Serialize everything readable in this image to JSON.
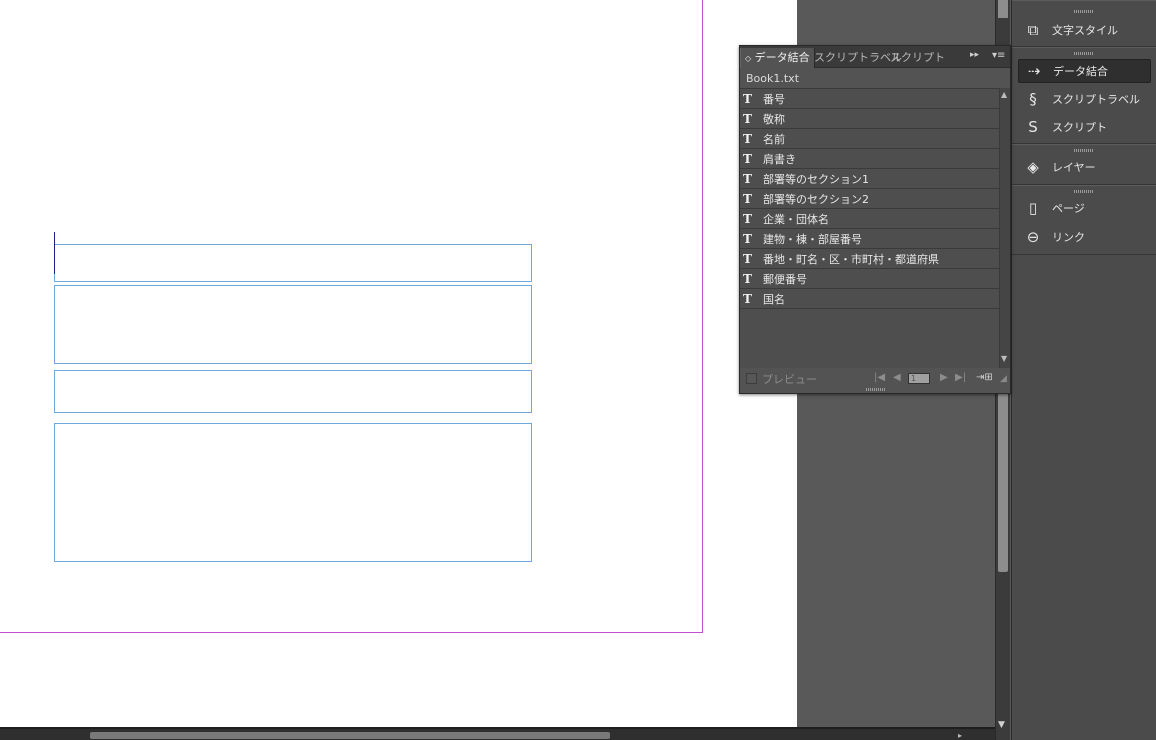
{
  "panel": {
    "tabs": [
      {
        "label": "データ結合"
      },
      {
        "label": "スクリプトラベル"
      },
      {
        "label": "スクリプト"
      }
    ],
    "collapse_glyph": "▸▸",
    "menu_glyph": "▾≡",
    "tab_arrow_glyph": "◇",
    "source_name": "Book1.txt",
    "field_icon_glyph": "T",
    "fields": [
      "番号",
      "敬称",
      "名前",
      "肩書き",
      "部署等のセクション1",
      "部署等のセクション2",
      "企業・団体名",
      "建物・棟・部屋番号",
      "番地・町名・区・市町村・都道府県",
      "郵便番号",
      "国名"
    ],
    "footer": {
      "preview_label": "プレビュー",
      "record_number": "1",
      "first_glyph": "|◀",
      "prev_glyph": "◀",
      "next_glyph": "▶",
      "last_glyph": "▶|",
      "create_glyph": "⇥⊞"
    }
  },
  "dock": {
    "items": [
      {
        "label": "文字スタイル",
        "icon": "character-styles-icon",
        "glyph": "⧉"
      },
      {
        "label": "データ結合",
        "icon": "data-merge-icon",
        "glyph": "⇢"
      },
      {
        "label": "スクリプトラベル",
        "icon": "script-label-icon",
        "glyph": "§"
      },
      {
        "label": "スクリプト",
        "icon": "script-icon",
        "glyph": "S"
      },
      {
        "label": "レイヤー",
        "icon": "layers-icon",
        "glyph": "◈"
      },
      {
        "label": "ページ",
        "icon": "pages-icon",
        "glyph": "▯"
      },
      {
        "label": "リンク",
        "icon": "links-icon",
        "glyph": "⊖"
      }
    ]
  },
  "colors": {
    "page_margin_border": "#c04fd0",
    "text_frame_border": "#6fa8dc",
    "panel_bg": "#535353",
    "dock_bg": "#4b4b4b"
  }
}
